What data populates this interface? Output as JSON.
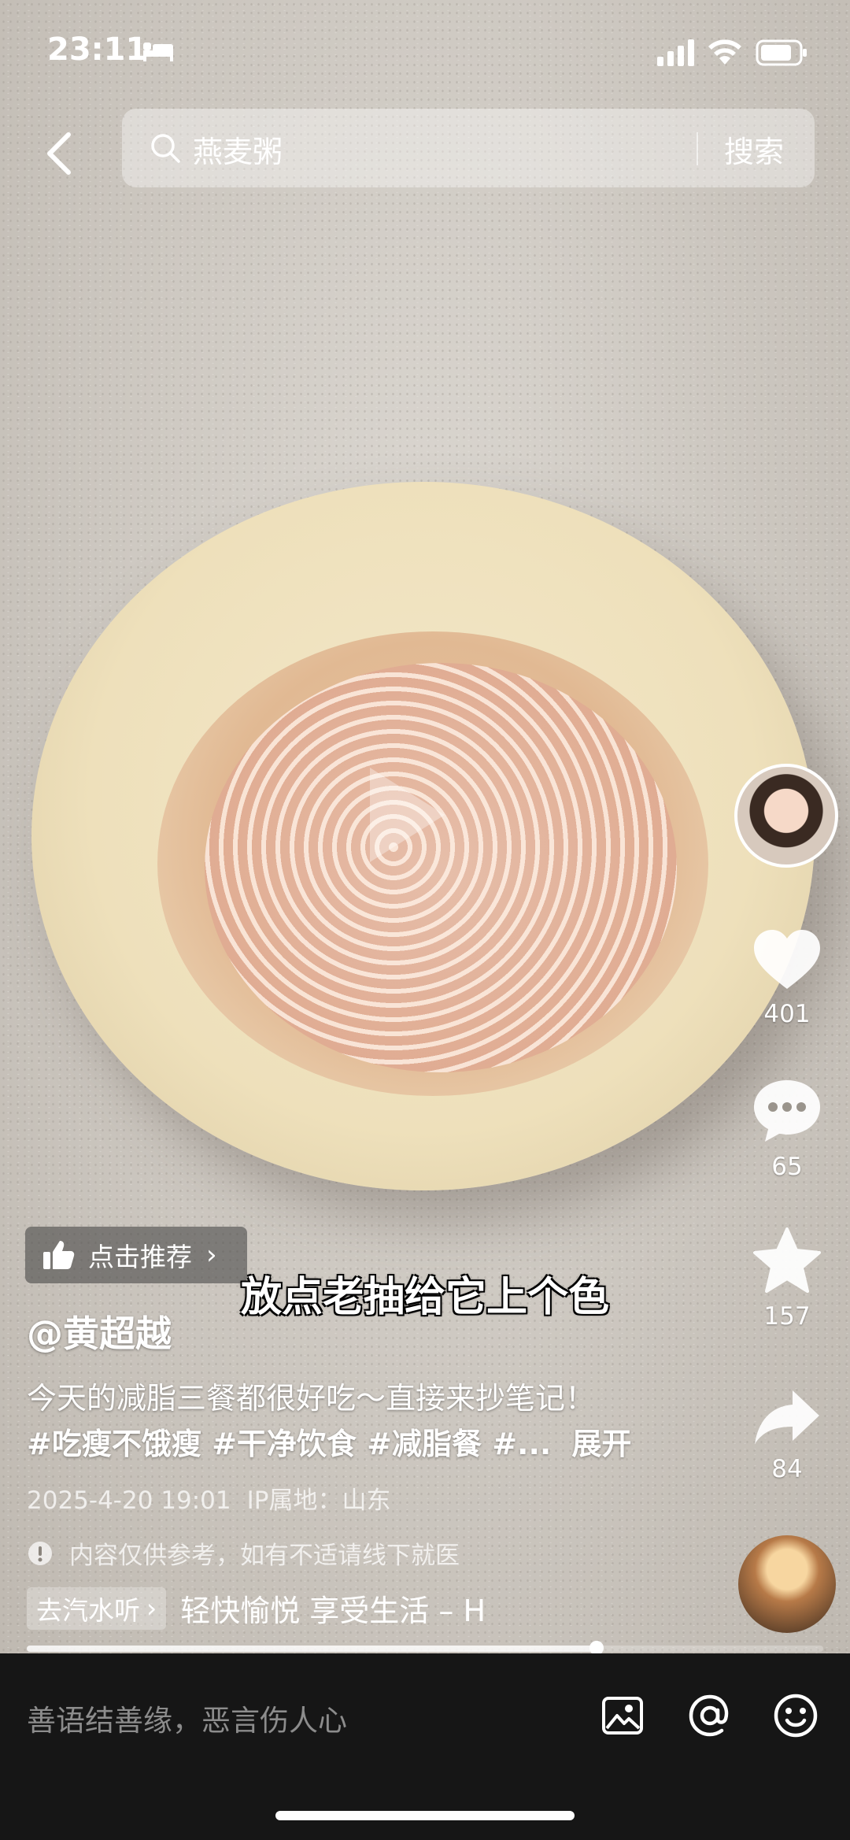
{
  "status_bar": {
    "time": "23:11"
  },
  "search": {
    "query": "燕麦粥",
    "button_label": "搜索"
  },
  "video": {
    "subtitle": "放点老抽给它上个色",
    "progress_percent": 71.5
  },
  "side_rail": {
    "likes": "401",
    "comments": "65",
    "favorites": "157",
    "shares": "84"
  },
  "post": {
    "recommend_label": "点击推荐",
    "author": "@黄超越",
    "description_line1": "今天的减脂三餐都很好吃～直接来抄笔记！",
    "description_line2": "#吃瘦不饿瘦 #干净饮食 #减脂餐 #...",
    "expand_label": "展开",
    "date": "2025-4-20 19:01",
    "location": "IP属地：山东",
    "notice": "内容仅供参考，如有不适请线下就医",
    "music_tag": "去汽水听",
    "music_title": "轻快愉悦 享受生活 – H"
  },
  "comment_bar": {
    "placeholder": "善语结善缘，恶言伤人心"
  },
  "colors": {
    "comment_bar_bg": "#161616",
    "text": "#ffffff"
  }
}
